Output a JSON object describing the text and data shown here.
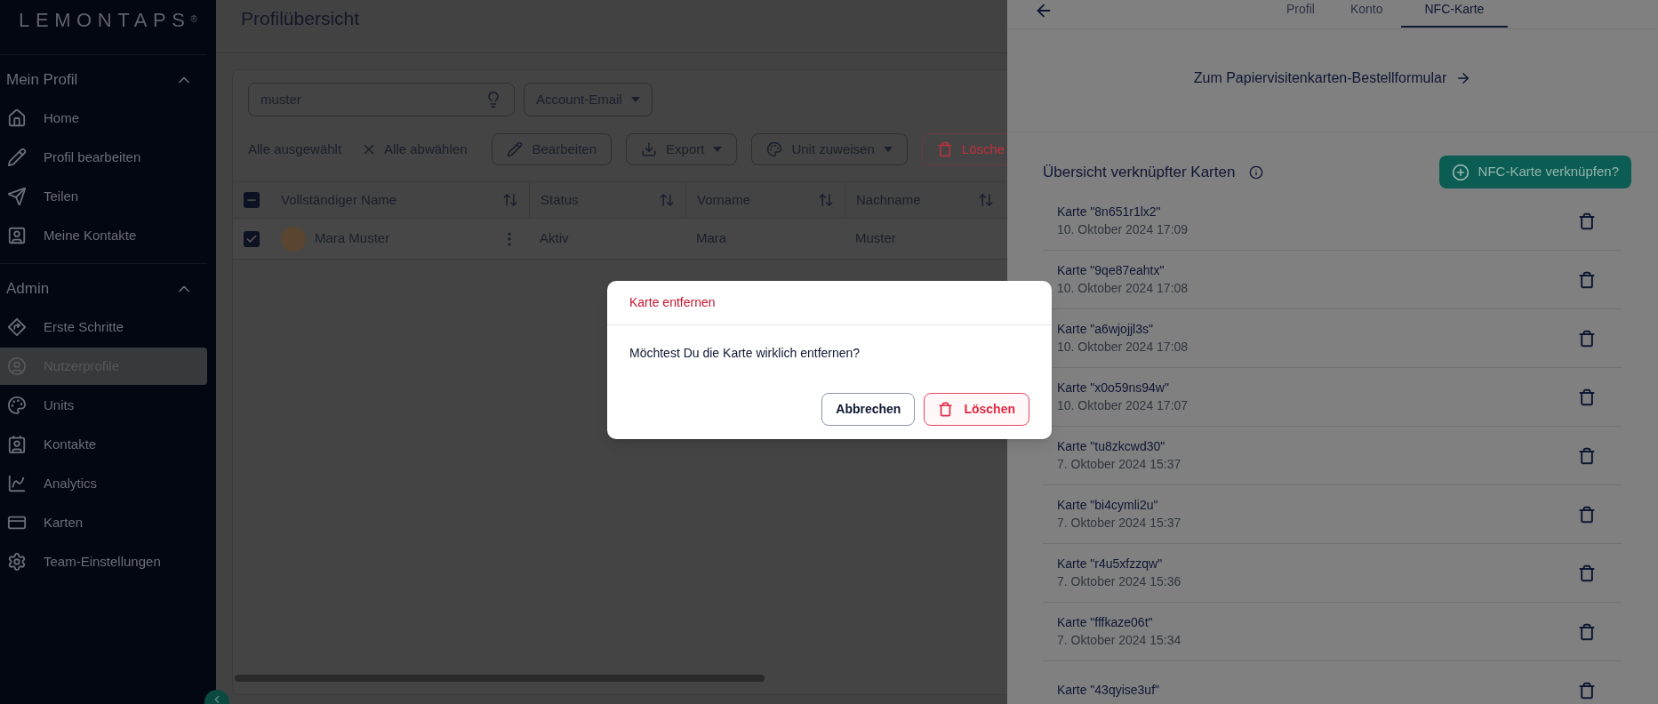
{
  "sidebar": {
    "logo": "LEMONTAPS",
    "logo_mark": "®",
    "sections": [
      {
        "title": "Mein Profil",
        "expanded": true,
        "items": [
          {
            "label": "Home",
            "selected": false
          },
          {
            "label": "Profil bearbeiten",
            "selected": false
          },
          {
            "label": "Teilen",
            "selected": false
          },
          {
            "label": "Meine Kontakte",
            "selected": false
          }
        ]
      },
      {
        "title": "Admin",
        "expanded": true,
        "items": [
          {
            "label": "Erste Schritte",
            "selected": false
          },
          {
            "label": "Nutzerprofile",
            "selected": true
          },
          {
            "label": "Units",
            "selected": false
          },
          {
            "label": "Kontakte",
            "selected": false
          },
          {
            "label": "Analytics",
            "selected": false
          },
          {
            "label": "Karten",
            "selected": false
          },
          {
            "label": "Team-Einstellungen",
            "selected": false
          }
        ]
      }
    ]
  },
  "main": {
    "title": "Profilübersicht",
    "search": {
      "value": "muster"
    },
    "filter": {
      "label": "Account-Email"
    },
    "selection_text": "Alle ausgewählt",
    "deselect": "Alle abwählen",
    "actions": [
      {
        "label": "Bearbeiten",
        "kind": "edit"
      },
      {
        "label": "Export",
        "kind": "export"
      },
      {
        "label": "Unit zuweisen",
        "kind": "unit"
      },
      {
        "label": "Lösche",
        "kind": "delete"
      }
    ],
    "table": {
      "select_all": {
        "indeterminate": true
      },
      "columns": [
        "Vollständiger Name",
        "Status",
        "Vorname",
        "Nachname"
      ],
      "rows": [
        {
          "checked": true,
          "cells": [
            "Mara Muster",
            "Aktiv",
            "Mara",
            "Muster"
          ]
        }
      ]
    }
  },
  "drawer": {
    "tabs": [
      {
        "label": "Profil",
        "selected": false
      },
      {
        "label": "Konto",
        "selected": false
      },
      {
        "label": "NFC-Karte",
        "selected": true
      }
    ],
    "order_link": "Zum Papiervisitenkarten-Bestellformular",
    "cards_title": "Übersicht verknüpfter Karten",
    "link_button": "NFC-Karte verknüpfen?",
    "cards": [
      {
        "name": "Karte \"8n651r1lx2\"",
        "date": "10. Oktober 2024 17:09"
      },
      {
        "name": "Karte \"9qe87eahtx\"",
        "date": "10. Oktober 2024 17:08"
      },
      {
        "name": "Karte \"a6wjojjl3s\"",
        "date": "10. Oktober 2024 17:08"
      },
      {
        "name": "Karte \"x0o59ns94w\"",
        "date": "10. Oktober 2024 17:07"
      },
      {
        "name": "Karte \"tu8zkcwd30\"",
        "date": "7. Oktober 2024 15:37"
      },
      {
        "name": "Karte \"bi4cymli2u\"",
        "date": "7. Oktober 2024 15:37"
      },
      {
        "name": "Karte \"r4u5xfzzqw\"",
        "date": "7. Oktober 2024 15:36"
      },
      {
        "name": "Karte \"fffkaze06t\"",
        "date": "7. Oktober 2024 15:34"
      },
      {
        "name": "Karte \"43qyise3uf\""
      }
    ]
  },
  "dialog": {
    "title": "Karte entfernen",
    "message": "Möchtest Du die Karte wirklich entfernen?",
    "buttons": [
      {
        "label": "Abbrechen",
        "kind": "cancel"
      },
      {
        "label": "Löschen",
        "kind": "danger"
      }
    ]
  }
}
